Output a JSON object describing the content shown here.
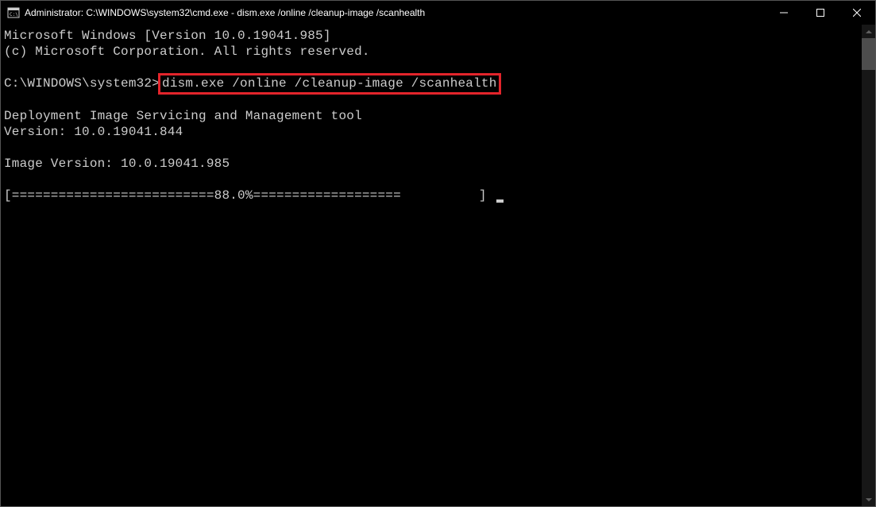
{
  "titlebar": {
    "text": "Administrator: C:\\WINDOWS\\system32\\cmd.exe - dism.exe  /online /cleanup-image /scanhealth"
  },
  "terminal": {
    "line1": "Microsoft Windows [Version 10.0.19041.985]",
    "line2": "(c) Microsoft Corporation. All rights reserved.",
    "blank1": "",
    "prompt": "C:\\WINDOWS\\system32>",
    "command": "dism.exe /online /cleanup-image /scanhealth",
    "blank2": "",
    "toolLine": "Deployment Image Servicing and Management tool",
    "versionLine": "Version: 10.0.19041.844",
    "blank3": "",
    "imageVersion": "Image Version: 10.0.19041.985",
    "blank4": "",
    "progress": "[==========================88.0%===================          ] "
  }
}
